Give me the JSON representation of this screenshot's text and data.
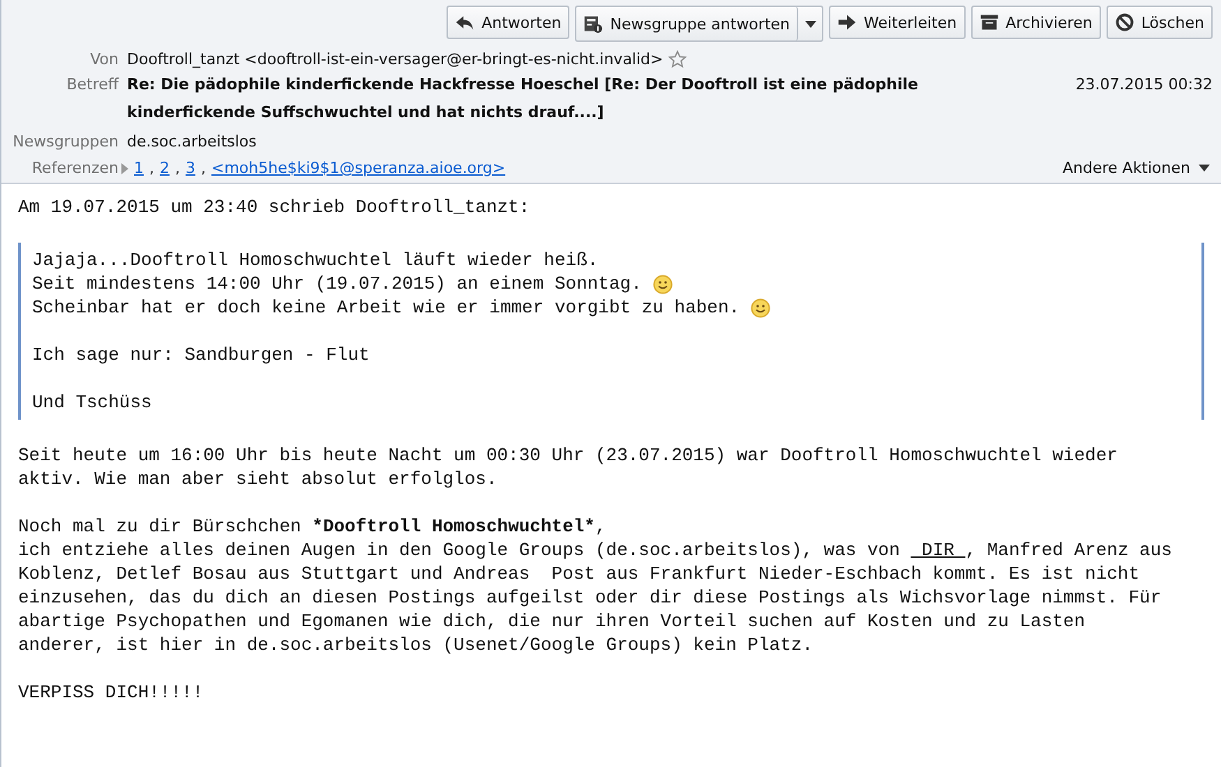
{
  "toolbar": [
    {
      "label": "Antworten",
      "dropdown": false
    },
    {
      "label": "Newsgruppe antworten",
      "dropdown": true
    },
    {
      "label": "Weiterleiten",
      "dropdown": false
    },
    {
      "label": "Archivieren",
      "dropdown": false
    },
    {
      "label": "Löschen",
      "dropdown": false
    }
  ],
  "header": {
    "from": {
      "label": "Von",
      "value": "Dooftroll_tanzt <dooftroll-ist-ein-versager@er-bringt-es-nicht.invalid>",
      "starred": false
    },
    "subject": {
      "label": "Betreff",
      "value": "Re: Die pädophile kinderfickende Hackfresse Hoeschel [Re: Der Dooftroll ist eine pädophile kinderfickende Suffschwuchtel und hat nichts drauf....]",
      "date": "23.07.2015 00:32"
    },
    "newsgroups": {
      "label": "Newsgruppen",
      "value": "de.soc.arbeitslos"
    },
    "references": {
      "label": "Referenzen",
      "separator": ",",
      "links": [
        "1",
        "2",
        "3",
        "<moh5he$ki9$1@speranza.aioe.org>"
      ]
    },
    "more_actions": "Andere Aktionen"
  },
  "body": {
    "attribution": "Am 19.07.2015 um 23:40 schrieb Dooftroll_tanzt:",
    "quote": [
      [
        {
          "text": "Jajaja...Dooftroll Homoschwuchtel läuft wieder heiß.",
          "smiley": false
        },
        {
          "text": "Seit mindestens 14:00 Uhr (19.07.2015) an einem Sonntag.",
          "smiley": true
        },
        {
          "text": "Scheinbar hat er doch keine Arbeit wie er immer vorgibt zu haben.",
          "smiley": true
        }
      ],
      [
        {
          "text": "Ich sage nur: Sandburgen - Flut",
          "smiley": false
        }
      ],
      [
        {
          "text": "Und Tschüss",
          "smiley": false
        }
      ]
    ],
    "paragraphs": [
      [
        {
          "text": "Seit heute um 16:00 Uhr bis heute Nacht um 00:30 Uhr (23.07.2015) war Dooftroll Homoschwuchtel wieder\naktiv. Wie man aber sieht absolut erfolglos."
        }
      ],
      [
        {
          "text": "Noch mal zu dir Bürschchen "
        },
        {
          "text": "*Dooftroll Homoschwuchtel*",
          "kind": "bold"
        },
        {
          "text": ",\nich entziehe alles deinen Augen in den Google Groups (de.soc.arbeitslos), was von "
        },
        {
          "text": " DIR ",
          "kind": "underline"
        },
        {
          "text": ", Manfred Arenz aus\nKoblenz, Detlef Bosau aus Stuttgart und Andreas  Post aus Frankfurt Nieder-Eschbach kommt. Es ist nicht\neinzusehen, das du dich an diesen Postings aufgeilst oder dir diese Postings als Wichsvorlage nimmst. Für\nabartige Psychopathen und Egomanen wie dich, die nur ihren Vorteil suchen auf Kosten und zu Lasten\nanderer, ist hier in de.soc.arbeitslos (Usenet/Google Groups) kein Platz."
        }
      ],
      [
        {
          "text": "VERPISS DICH!!!!!"
        }
      ]
    ]
  }
}
